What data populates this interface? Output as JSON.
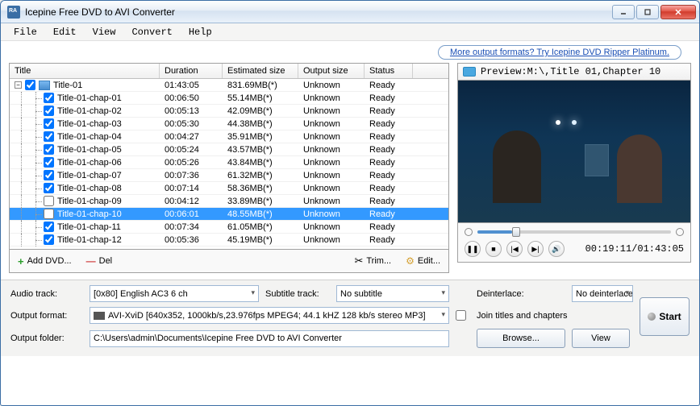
{
  "window_title": "Icepine Free DVD to AVI Converter",
  "menu": [
    "File",
    "Edit",
    "View",
    "Convert",
    "Help"
  ],
  "promo_text": "More output formats? Try Icepine DVD Ripper Platinum.",
  "columns": [
    "Title",
    "Duration",
    "Estimated size",
    "Output size",
    "Status"
  ],
  "root_title": {
    "name": "Title-01",
    "duration": "01:43:05",
    "est": "831.69MB(*)",
    "out": "Unknown",
    "status": "Ready",
    "checked": true
  },
  "chapters": [
    {
      "name": "Title-01-chap-01",
      "duration": "00:06:50",
      "est": "55.14MB(*)",
      "out": "Unknown",
      "status": "Ready",
      "checked": true,
      "selected": false
    },
    {
      "name": "Title-01-chap-02",
      "duration": "00:05:13",
      "est": "42.09MB(*)",
      "out": "Unknown",
      "status": "Ready",
      "checked": true,
      "selected": false
    },
    {
      "name": "Title-01-chap-03",
      "duration": "00:05:30",
      "est": "44.38MB(*)",
      "out": "Unknown",
      "status": "Ready",
      "checked": true,
      "selected": false
    },
    {
      "name": "Title-01-chap-04",
      "duration": "00:04:27",
      "est": "35.91MB(*)",
      "out": "Unknown",
      "status": "Ready",
      "checked": true,
      "selected": false
    },
    {
      "name": "Title-01-chap-05",
      "duration": "00:05:24",
      "est": "43.57MB(*)",
      "out": "Unknown",
      "status": "Ready",
      "checked": true,
      "selected": false
    },
    {
      "name": "Title-01-chap-06",
      "duration": "00:05:26",
      "est": "43.84MB(*)",
      "out": "Unknown",
      "status": "Ready",
      "checked": true,
      "selected": false
    },
    {
      "name": "Title-01-chap-07",
      "duration": "00:07:36",
      "est": "61.32MB(*)",
      "out": "Unknown",
      "status": "Ready",
      "checked": true,
      "selected": false
    },
    {
      "name": "Title-01-chap-08",
      "duration": "00:07:14",
      "est": "58.36MB(*)",
      "out": "Unknown",
      "status": "Ready",
      "checked": true,
      "selected": false
    },
    {
      "name": "Title-01-chap-09",
      "duration": "00:04:12",
      "est": "33.89MB(*)",
      "out": "Unknown",
      "status": "Ready",
      "checked": false,
      "selected": false
    },
    {
      "name": "Title-01-chap-10",
      "duration": "00:06:01",
      "est": "48.55MB(*)",
      "out": "Unknown",
      "status": "Ready",
      "checked": false,
      "selected": true
    },
    {
      "name": "Title-01-chap-11",
      "duration": "00:07:34",
      "est": "61.05MB(*)",
      "out": "Unknown",
      "status": "Ready",
      "checked": true,
      "selected": false
    },
    {
      "name": "Title-01-chap-12",
      "duration": "00:05:36",
      "est": "45.19MB(*)",
      "out": "Unknown",
      "status": "Ready",
      "checked": true,
      "selected": false
    }
  ],
  "toolbar": {
    "add_dvd": "Add DVD...",
    "del": "Del",
    "trim": "Trim...",
    "edit": "Edit..."
  },
  "preview": {
    "title": "Preview:M:\\,Title 01,Chapter 10",
    "time": "00:19:11/01:43:05"
  },
  "form": {
    "audio_track_label": "Audio track:",
    "audio_track_value": "[0x80] English AC3 6 ch",
    "subtitle_track_label": "Subtitle track:",
    "subtitle_track_value": "No subtitle",
    "deinterlace_label": "Deinterlace:",
    "deinterlace_value": "No deinterlace",
    "output_format_label": "Output format:",
    "output_format_value": "AVI-XviD [640x352, 1000kb/s,23.976fps MPEG4;  44.1 kHZ 128 kb/s stereo MP3]",
    "join_label": "Join titles and chapters",
    "output_folder_label": "Output folder:",
    "output_folder_value": "C:\\Users\\admin\\Documents\\Icepine Free DVD to AVI Converter",
    "browse": "Browse...",
    "view": "View",
    "start": "Start"
  }
}
